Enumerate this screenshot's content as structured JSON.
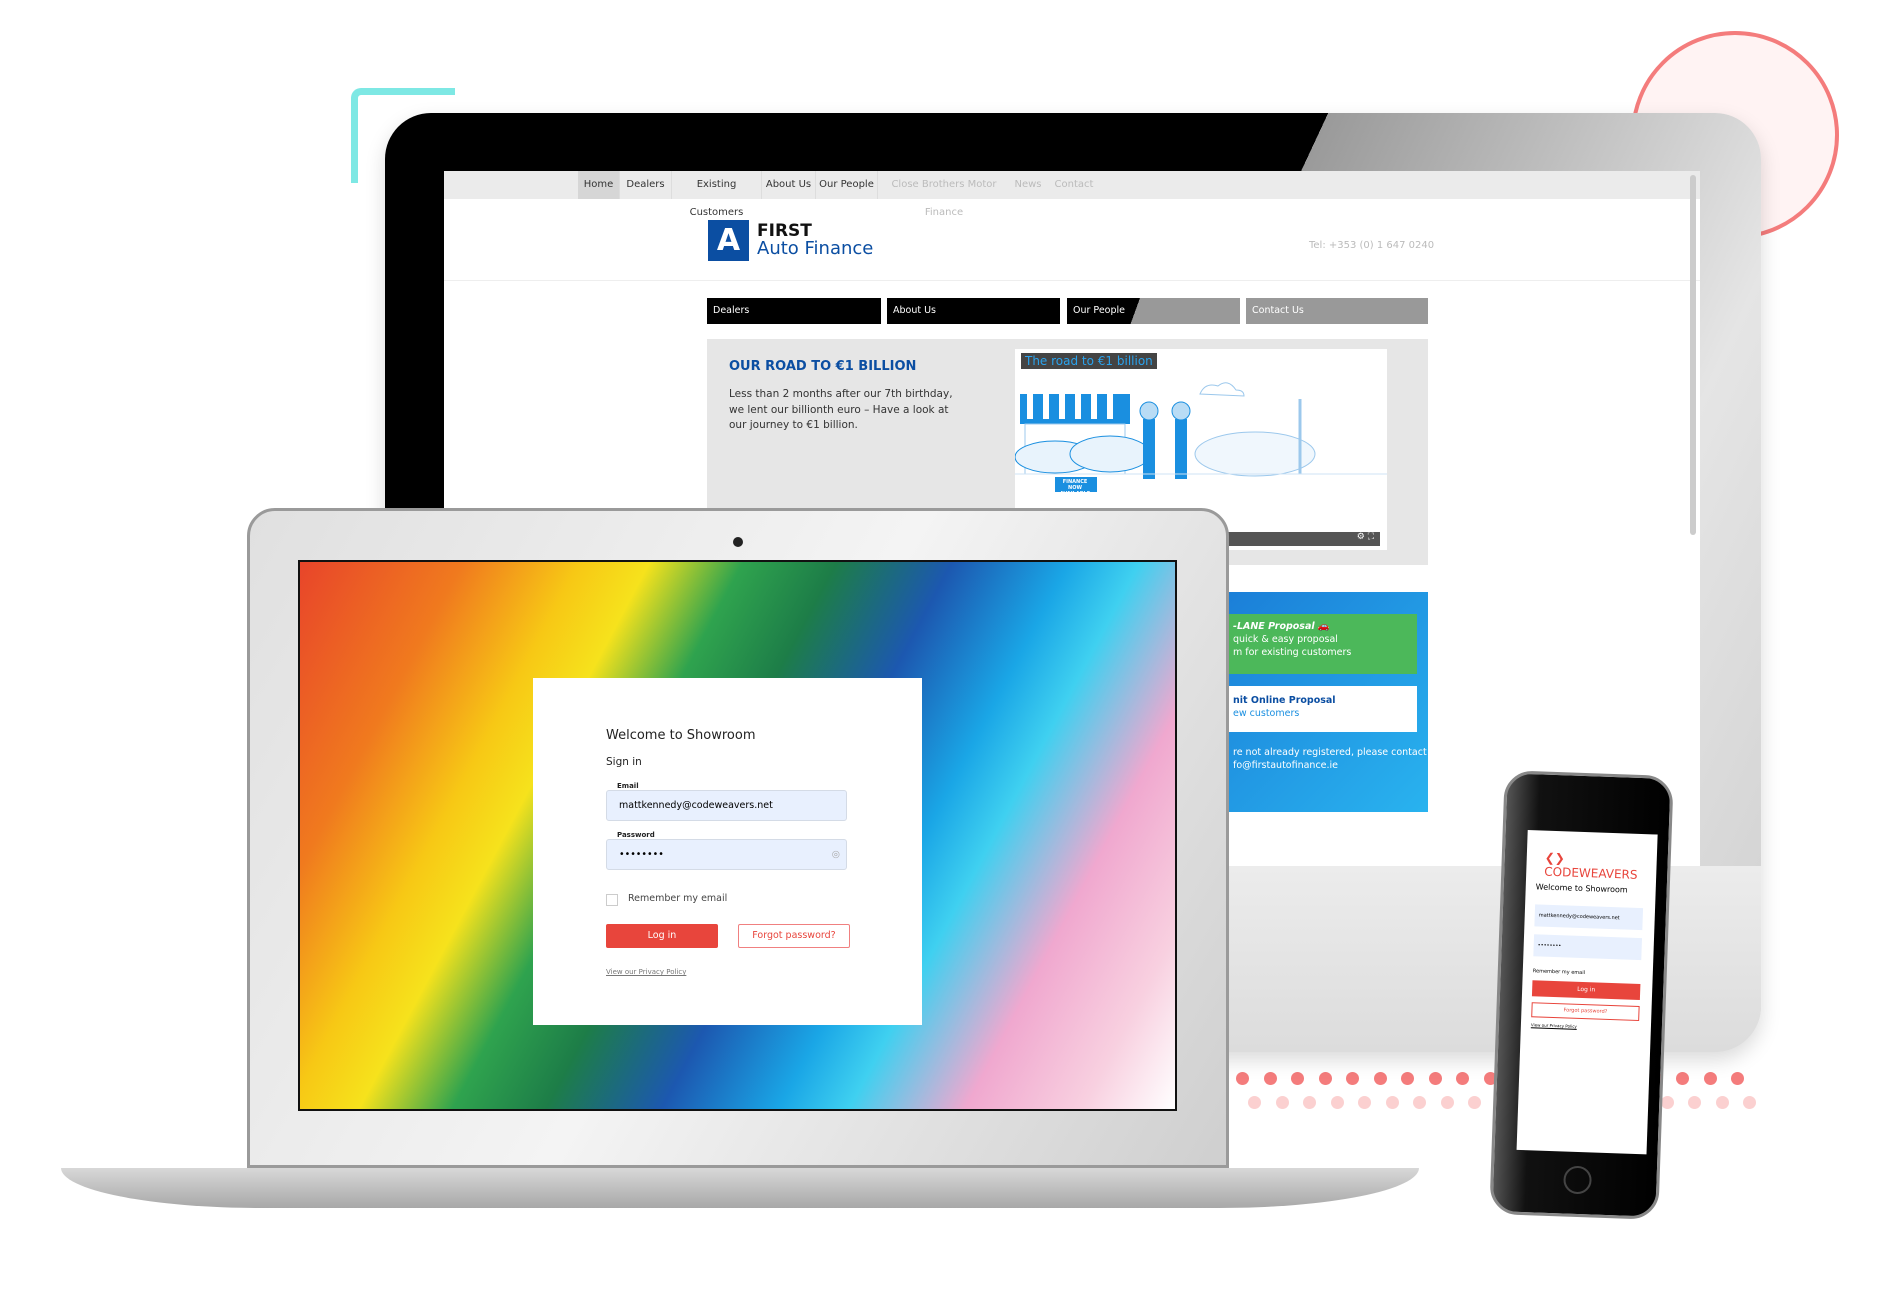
{
  "colors": {
    "accent_red": "#e8453c",
    "brand_blue": "#0b4ea2",
    "teal": "#7ee8e4",
    "pink": "#f47c7c",
    "green": "#4cb85a"
  },
  "website": {
    "top_nav": [
      "Home",
      "Dealers",
      "Existing Customers",
      "About Us",
      "Our People",
      "Close Brothers Motor Finance",
      "News",
      "Contact"
    ],
    "logo": {
      "line1": "FIRST",
      "line2": "Auto Finance",
      "icon": "A"
    },
    "tel": "Tel: +353 (0) 1 647 0240",
    "tabs": [
      "Dealers",
      "About Us",
      "Our People",
      "Contact Us"
    ],
    "feature": {
      "title": "OUR ROAD TO €1 BILLION",
      "text": "Less than 2 months after our 7th birthday, we lent our billionth euro – Have a look at our journey to €1 billion."
    },
    "video": {
      "title": "The road to €1 billion",
      "sign": "FINANCE NOW AVAILABLE"
    },
    "fastlane": {
      "title": "-LANE Proposal",
      "line1": "quick & easy proposal",
      "line2": "m for existing customers"
    },
    "online": {
      "title": "nit Online Proposal",
      "sub": "ew customers"
    },
    "contact": {
      "line1": "re not already registered, please contact",
      "line2": "fo@firstautofinance.ie"
    }
  },
  "login": {
    "title": "Welcome to Showroom",
    "subtitle": "Sign in",
    "email_label": "Email",
    "email_value": "mattkennedy@codeweavers.net",
    "password_label": "Password",
    "password_value": "••••••••",
    "remember": "Remember my email",
    "login_button": "Log in",
    "forgot_button": "Forgot password?",
    "privacy": "View our Privacy Policy"
  },
  "phone": {
    "brand": "CODEWEAVERS"
  }
}
